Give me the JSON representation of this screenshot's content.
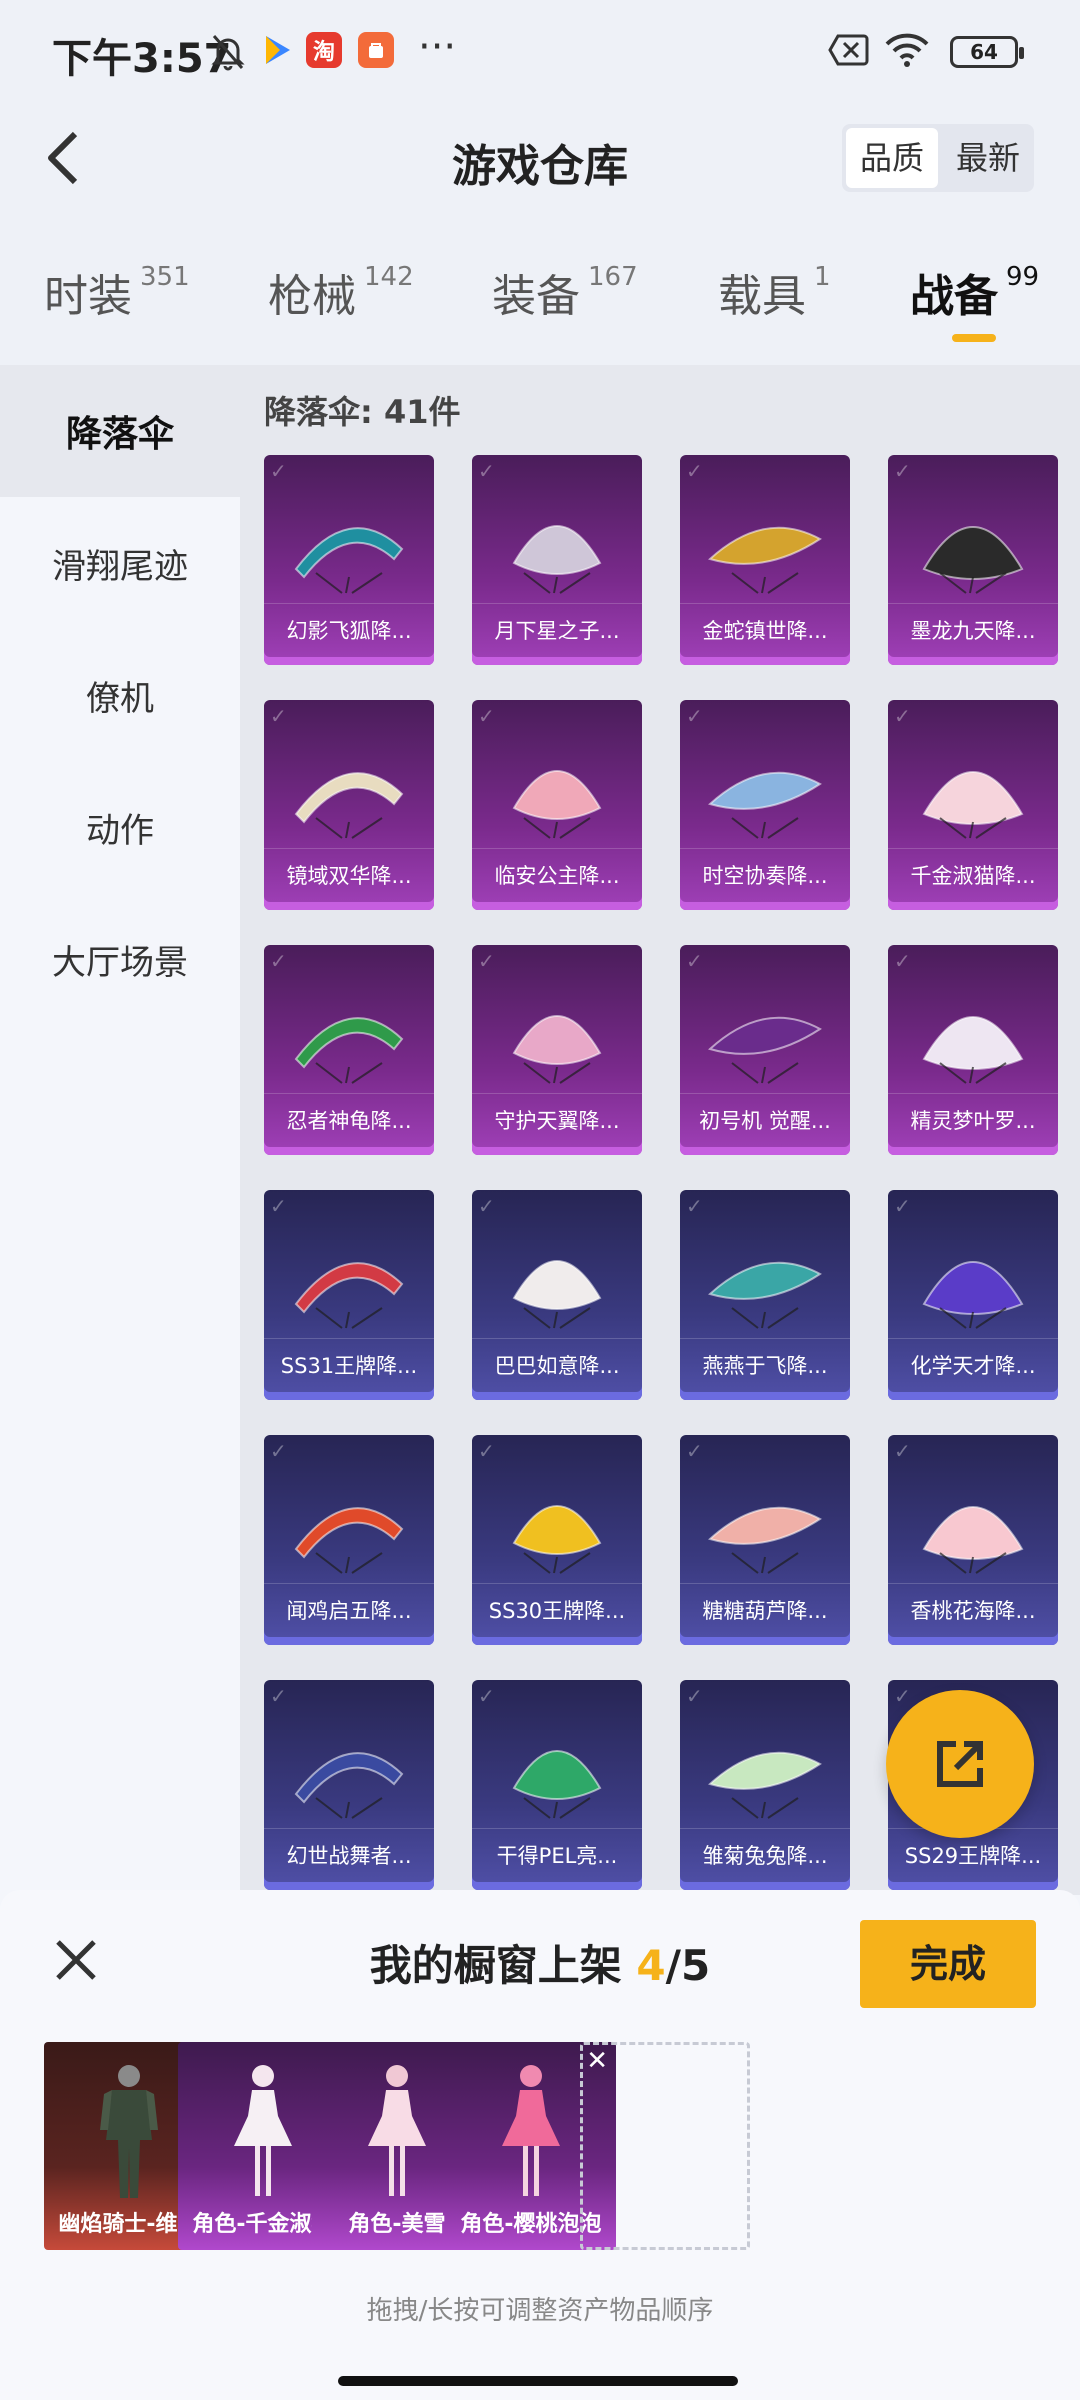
{
  "status_bar": {
    "time": "下午3:57",
    "battery": "64",
    "app_badge": "淘"
  },
  "header": {
    "title": "游戏仓库",
    "sort_options": [
      "品质",
      "最新"
    ]
  },
  "tabs": [
    {
      "label": "时装",
      "count": "351"
    },
    {
      "label": "枪械",
      "count": "142"
    },
    {
      "label": "装备",
      "count": "167"
    },
    {
      "label": "载具",
      "count": "1"
    },
    {
      "label": "战备",
      "count": "99"
    }
  ],
  "sidebar": {
    "items": [
      "降落伞",
      "滑翔尾迹",
      "僚机",
      "动作",
      "大厅场景"
    ]
  },
  "section": {
    "title": "降落伞: 41件"
  },
  "items": [
    {
      "name": "幻影飞狐降...",
      "rarity": "purple",
      "color": "#1f8fa0"
    },
    {
      "name": "月下星之子...",
      "rarity": "purple",
      "color": "#cfc6d8"
    },
    {
      "name": "金蛇镇世降...",
      "rarity": "purple",
      "color": "#d4a32e"
    },
    {
      "name": "墨龙九天降...",
      "rarity": "purple",
      "color": "#2a2a2a"
    },
    {
      "name": "镜域双华降...",
      "rarity": "purple",
      "color": "#e8dcc0"
    },
    {
      "name": "临安公主降...",
      "rarity": "purple",
      "color": "#f0a8b8"
    },
    {
      "name": "时空协奏降...",
      "rarity": "purple",
      "color": "#8ab4e0"
    },
    {
      "name": "千金淑猫降...",
      "rarity": "purple",
      "color": "#f6d4dc"
    },
    {
      "name": "忍者神龟降...",
      "rarity": "purple",
      "color": "#2f9a4a"
    },
    {
      "name": "守护天翼降...",
      "rarity": "purple",
      "color": "#e8a8c8"
    },
    {
      "name": "初号机 觉醒...",
      "rarity": "purple",
      "color": "#6a2c8c"
    },
    {
      "name": "精灵梦叶罗...",
      "rarity": "purple",
      "color": "#eee6f2"
    },
    {
      "name": "SS31王牌降...",
      "rarity": "blue",
      "color": "#d23a44"
    },
    {
      "name": "巴巴如意降...",
      "rarity": "blue",
      "color": "#f0ecec"
    },
    {
      "name": "燕燕于飞降...",
      "rarity": "blue",
      "color": "#3aa6a6"
    },
    {
      "name": "化学天才降...",
      "rarity": "blue",
      "color": "#5a3cc8"
    },
    {
      "name": "闻鸡启五降...",
      "rarity": "blue",
      "color": "#e04a2a"
    },
    {
      "name": "SS30王牌降...",
      "rarity": "blue",
      "color": "#f0c020"
    },
    {
      "name": "糖糖葫芦降...",
      "rarity": "blue",
      "color": "#f0b0a8"
    },
    {
      "name": "香桃花海降...",
      "rarity": "blue",
      "color": "#f8c8d0"
    },
    {
      "name": "幻世战舞者...",
      "rarity": "blue",
      "color": "#3a4aa0"
    },
    {
      "name": "干得PEL亮...",
      "rarity": "blue",
      "color": "#2ea868"
    },
    {
      "name": "雏菊兔兔降...",
      "rarity": "blue",
      "color": "#c8e8c0"
    },
    {
      "name": "SS29王牌降...",
      "rarity": "blue",
      "color": "#e07a40"
    }
  ],
  "panel": {
    "title": "我的橱窗上架",
    "count_current": "4",
    "count_total": "/5",
    "done_label": "完成",
    "hint": "拖拽/长按可调整资产物品顺序",
    "slots": [
      {
        "name": "幽焰骑士-维塔",
        "rarity": "red"
      },
      {
        "name": "角色-千金淑猫",
        "rarity": "purple"
      },
      {
        "name": "角色-美雪",
        "rarity": "purple"
      },
      {
        "name": "角色-樱桃泡泡",
        "rarity": "purple"
      }
    ]
  },
  "colors": {
    "accent": "#f6b21a"
  }
}
